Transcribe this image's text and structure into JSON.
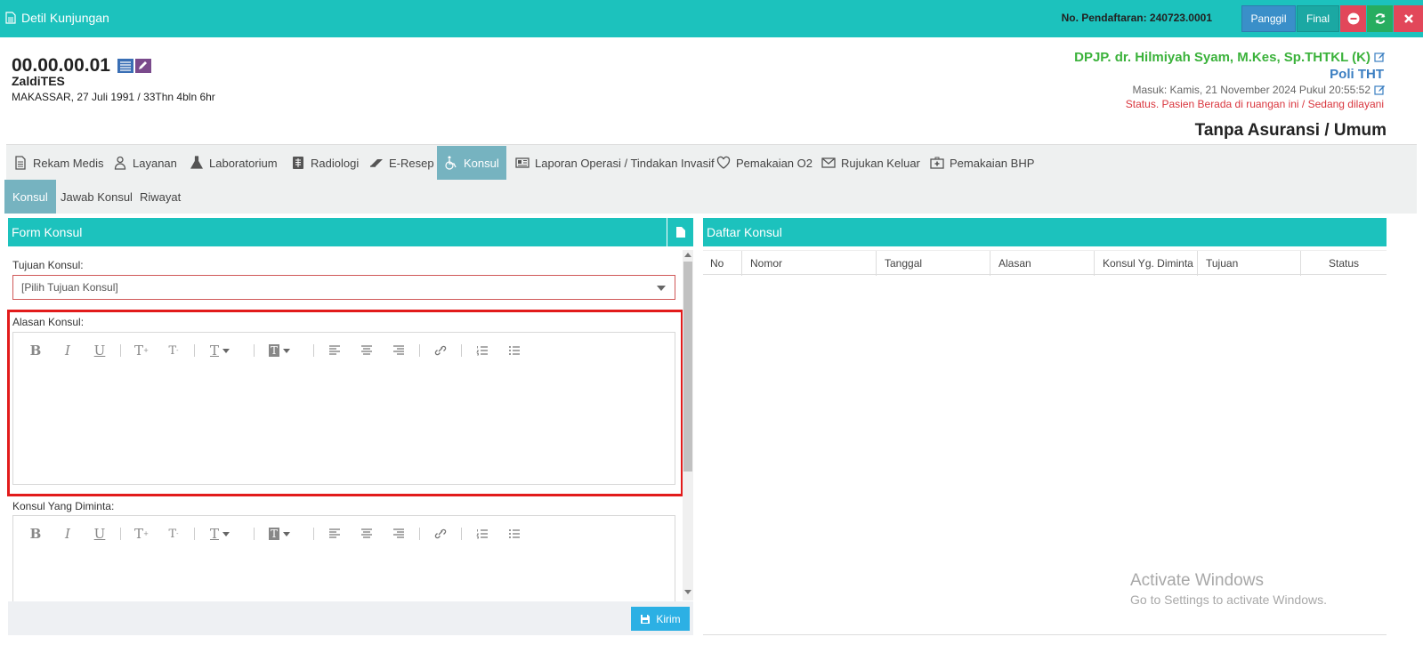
{
  "header": {
    "title": "Detil Kunjungan",
    "registration": "No. Pendaftaran: 240723.0001",
    "panggil_label": "Panggil",
    "final_label": "Final"
  },
  "patient": {
    "id": "00.00.00.01",
    "name": "ZaldiTES",
    "birth": "MAKASSAR, 27 Juli 1991 / 33Thn 4bln 6hr",
    "dpjp": "DPJP. dr. Hilmiyah Syam, M.Kes, Sp.THTKL (K)",
    "poli": "Poli THT",
    "masuk": "Masuk: Kamis, 21 November 2024 Pukul 20:55:52",
    "status": "Status. Pasien Berada di ruangan ini / Sedang dilayani",
    "insurance": "Tanpa Asuransi / Umum"
  },
  "tabs": [
    {
      "label": "Rekam Medis",
      "icon": "file-icon"
    },
    {
      "label": "Layanan",
      "icon": "doctor-icon"
    },
    {
      "label": "Laboratorium",
      "icon": "flask-icon"
    },
    {
      "label": "Radiologi",
      "icon": "xray-icon"
    },
    {
      "label": "E-Resep",
      "icon": "eraser-icon"
    },
    {
      "label": "Konsul",
      "icon": "wheelchair-icon"
    },
    {
      "label": "Laporan Operasi / Tindakan Invasif",
      "icon": "newspaper-icon"
    },
    {
      "label": "Pemakaian O2",
      "icon": "heart-icon"
    },
    {
      "label": "Rujukan Keluar",
      "icon": "envelope-icon"
    },
    {
      "label": "Pemakaian BHP",
      "icon": "medkit-icon"
    }
  ],
  "subtabs": [
    "Konsul",
    "Jawab Konsul",
    "Riwayat"
  ],
  "form": {
    "title": "Form Konsul",
    "tujuan_label": "Tujuan Konsul:",
    "tujuan_value": "[Pilih Tujuan Konsul]",
    "alasan_label": "Alasan Konsul:",
    "diminta_label": "Konsul Yang Diminta:",
    "submit_label": "Kirim"
  },
  "list": {
    "title": "Daftar Konsul",
    "columns": [
      "No",
      "Nomor",
      "Tanggal",
      "Alasan",
      "Konsul Yg. Diminta",
      "Tujuan",
      "Status"
    ]
  },
  "watermark": {
    "line1": "Activate Windows",
    "line2": "Go to Settings to activate Windows."
  },
  "colors": {
    "header_bg": "#1cc2bd",
    "active_tab": "#76b3c0",
    "dpjp": "#3bb23b",
    "poli": "#3a7ec1",
    "status": "#d9363e",
    "highlight": "#e21b1b"
  }
}
